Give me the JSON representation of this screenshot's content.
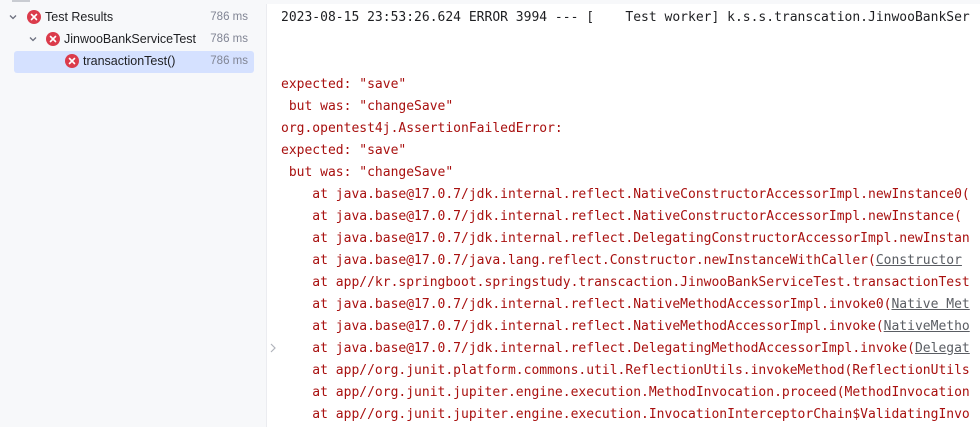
{
  "tree": {
    "root": {
      "label": "Test Results",
      "time": "786 ms"
    },
    "suite": {
      "label": "JinwooBankServiceTest",
      "time": "786 ms"
    },
    "test": {
      "label": "transactionTest()",
      "time": "786 ms"
    }
  },
  "console": {
    "log_line": "2023-08-15 23:53:26.624 ERROR 3994 --- [    Test worker] k.s.s.transcation.JinwooBankSer",
    "lines": [
      {
        "text": "expected: \"save\""
      },
      {
        "text": " but was: \"changeSave\""
      },
      {
        "text": "org.opentest4j.AssertionFailedError:"
      },
      {
        "text": "expected: \"save\""
      },
      {
        "text": " but was: \"changeSave\""
      },
      {
        "text": "    at java.base@17.0.7/jdk.internal.reflect.NativeConstructorAccessorImpl.newInstance0(",
        "link": ""
      },
      {
        "text": "    at java.base@17.0.7/jdk.internal.reflect.NativeConstructorAccessorImpl.newInstance(",
        "link": ""
      },
      {
        "text": "    at java.base@17.0.7/jdk.internal.reflect.DelegatingConstructorAccessorImpl.newInstan",
        "link": ""
      },
      {
        "text": "    at java.base@17.0.7/java.lang.reflect.Constructor.newInstanceWithCaller(",
        "link": "Constructor"
      },
      {
        "text": "    at app//kr.springboot.springstudy.transcaction.JinwooBankServiceTest.transactionTest",
        "link": ""
      },
      {
        "text": "    at java.base@17.0.7/jdk.internal.reflect.NativeMethodAccessorImpl.invoke0(",
        "link": "Native Met"
      },
      {
        "text": "    at java.base@17.0.7/jdk.internal.reflect.NativeMethodAccessorImpl.invoke(",
        "link": "NativeMetho"
      },
      {
        "text": "    at java.base@17.0.7/jdk.internal.reflect.DelegatingMethodAccessorImpl.invoke(",
        "link": "Delegat"
      },
      {
        "text": "    at app//org.junit.platform.commons.util.ReflectionUtils.invokeMethod(ReflectionUtils",
        "link": ""
      },
      {
        "text": "    at app//org.junit.jupiter.engine.execution.MethodInvocation.proceed(MethodInvocation",
        "link": ""
      },
      {
        "text": "    at app//org.junit.jupiter.engine.execution.InvocationInterceptorChain$ValidatingInvo",
        "link": ""
      }
    ]
  },
  "colors": {
    "fail_icon": "#db3b4b",
    "error_text": "#a8100f",
    "selection": "#d5e1ff"
  },
  "icons": [
    "chevron-down-icon",
    "test-failed-icon",
    "fold-chevron-icon"
  ]
}
